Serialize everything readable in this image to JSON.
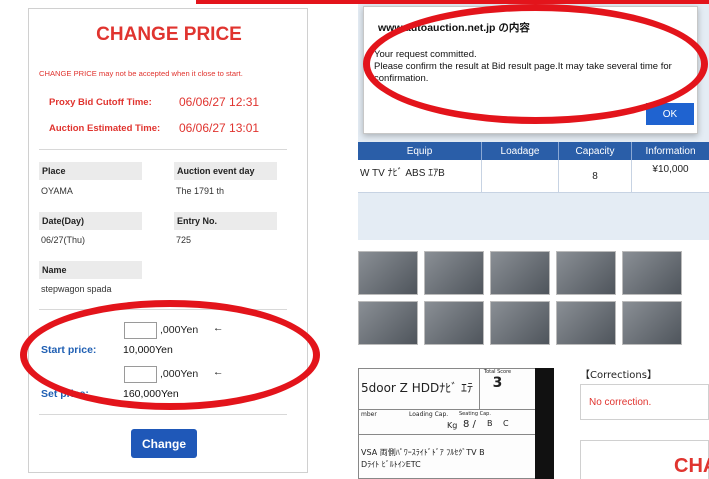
{
  "left_panel": {
    "title": "CHANGE PRICE",
    "warning": "CHANGE PRICE may not be accepted when it close to start.",
    "proxy_label": "Proxy Bid Cutoff Time:",
    "proxy_value": "06/06/27 12:31",
    "estimated_label": "Auction Estimated Time:",
    "estimated_value": "06/06/27 13:01",
    "place_label": "Place",
    "place_value": "OYAMA",
    "event_label": "Auction event day",
    "event_value": "The 1791 th",
    "date_label": "Date(Day)",
    "date_value": "06/27(Thu)",
    "entry_label": "Entry No.",
    "entry_value": "725",
    "name_label": "Name",
    "name_value": "stepwagon spada",
    "start_unit": ",000Yen",
    "start_arrow": "←",
    "start_label": "Start price:",
    "start_value": "10,000Yen",
    "set_unit": ",000Yen",
    "set_arrow": "←",
    "set_label": "Set price:",
    "set_value": "160,000Yen",
    "change_button": "Change"
  },
  "dialog": {
    "title": "www.autoauction.net.jp の内容",
    "line1": "Your request committed.",
    "line2": "Please confirm the result at Bid result page.It may take several time for confirmation.",
    "ok_button": "OK"
  },
  "table": {
    "headers": [
      "Equip",
      "Loadage",
      "Capacity",
      "Information"
    ],
    "row": {
      "equip": "W TV ﾅﾋﾞ ABS ｴｱB",
      "loadage": "",
      "capacity": "8",
      "information": "¥10,000"
    }
  },
  "sheet": {
    "model": "5door   Z HDDﾅﾋﾞ ｴﾃ",
    "score_label": "Total Score",
    "score_value": "3",
    "number_label": "mber",
    "loading_label": "Loading Cap.",
    "seating_label": "Seating Cap.",
    "kg": "Kg",
    "seats": "8 /",
    "interior": "B",
    "exterior": "C",
    "equip_line1": "VSA  両側ﾊﾟﾜｰｽﾗｲﾄﾞﾄﾞｱ  ﾌﾙｾｸﾞTV  B",
    "equip_line2": "Dﾗｲﾄ  ﾋﾞﾙﾄｲﾝETC"
  },
  "corrections": {
    "title": "【Corrections】",
    "value": "No correction."
  },
  "bottom_banner": {
    "text": "CHA"
  },
  "colors": {
    "accent_red": "#e0342f",
    "annotation_red": "#e3141b",
    "button_blue": "#1f58b8",
    "header_blue": "#2a5ea8"
  }
}
